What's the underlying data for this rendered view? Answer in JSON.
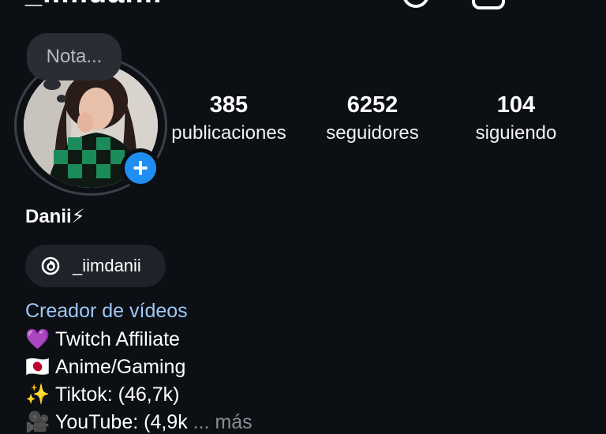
{
  "header": {
    "username": "_iimdanii",
    "icons": [
      "threads-icon",
      "add-post-icon",
      "menu-icon"
    ]
  },
  "note": {
    "placeholder": "Nota..."
  },
  "add_story_symbol": "+",
  "stats": {
    "posts": {
      "value": "385",
      "label": "publicaciones"
    },
    "followers": {
      "value": "6252",
      "label": "seguidores"
    },
    "following": {
      "value": "104",
      "label": "siguiendo"
    }
  },
  "profile": {
    "name": "Danii⚡",
    "threads_handle": "_iimdanii",
    "category": "Creador de vídeos",
    "bio": [
      {
        "emoji": "💜",
        "text": "Twitch Affiliate"
      },
      {
        "emoji": "🇯🇵",
        "text": "Anime/Gaming"
      },
      {
        "emoji": "✨",
        "text": "Tiktok: (46,7k)"
      },
      {
        "emoji": "🎥",
        "text": "YouTube: (4,9k"
      }
    ],
    "more_label": "... más"
  },
  "colors": {
    "background": "#0c0f14",
    "accent": "#1f8ef1",
    "category_link": "#9fc7f5",
    "pill": "#1f2228"
  }
}
